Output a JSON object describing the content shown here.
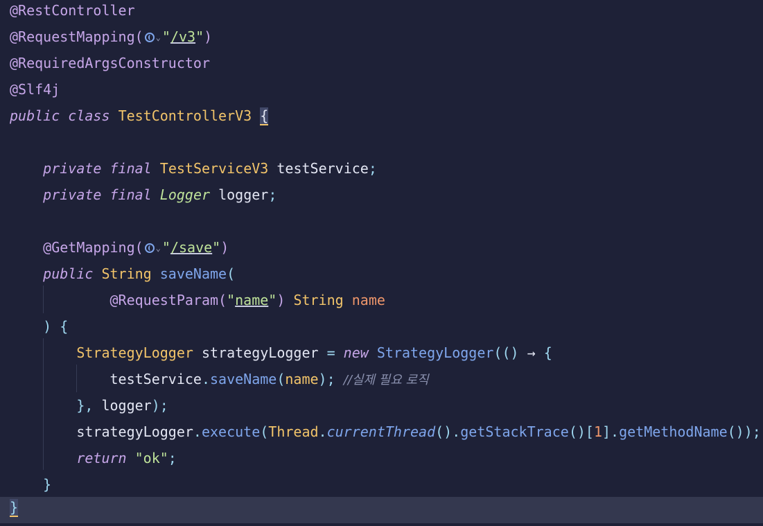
{
  "code": {
    "l1": "@RestController",
    "l2_ann": "@RequestMapping(",
    "l2_path": "/v3",
    "l3": "@RequiredArgsConstructor",
    "l4": "@Slf4j",
    "l5_public": "public",
    "l5_class": "class",
    "l5_name": "TestControllerV3",
    "l7_private": "private",
    "l7_final": "final",
    "l7_type": "TestServiceV3",
    "l7_var": "testService",
    "l8_type": "Logger",
    "l8_var": "logger",
    "l10_ann": "@GetMapping(",
    "l10_path": "/save",
    "l11_type": "String",
    "l11_fn": "saveName",
    "l12_ann": "@RequestParam(",
    "l12_str": "name",
    "l12_param": "name",
    "l14_type": "StrategyLogger",
    "l14_var": "strategyLogger",
    "l14_new": "new",
    "l15_obj": "testService",
    "l15_fn": "saveName",
    "l15_arg": "name",
    "l15_comment": "//실제 필요 로직",
    "l16_logger": "logger",
    "l17_var": "strategyLogger",
    "l17_execute": "execute",
    "l17_thread": "Thread",
    "l17_current": "currentThread",
    "l17_stack": "getStackTrace",
    "l17_index": "1",
    "l17_method": "getMethodName",
    "l18_return": "return",
    "l18_str": "\"ok\""
  },
  "icons": {
    "url_icon": "globe-icon",
    "dropdown": "chevron-down-icon"
  },
  "colors": {
    "background": "#1e2137",
    "current_line": "#34384f"
  }
}
